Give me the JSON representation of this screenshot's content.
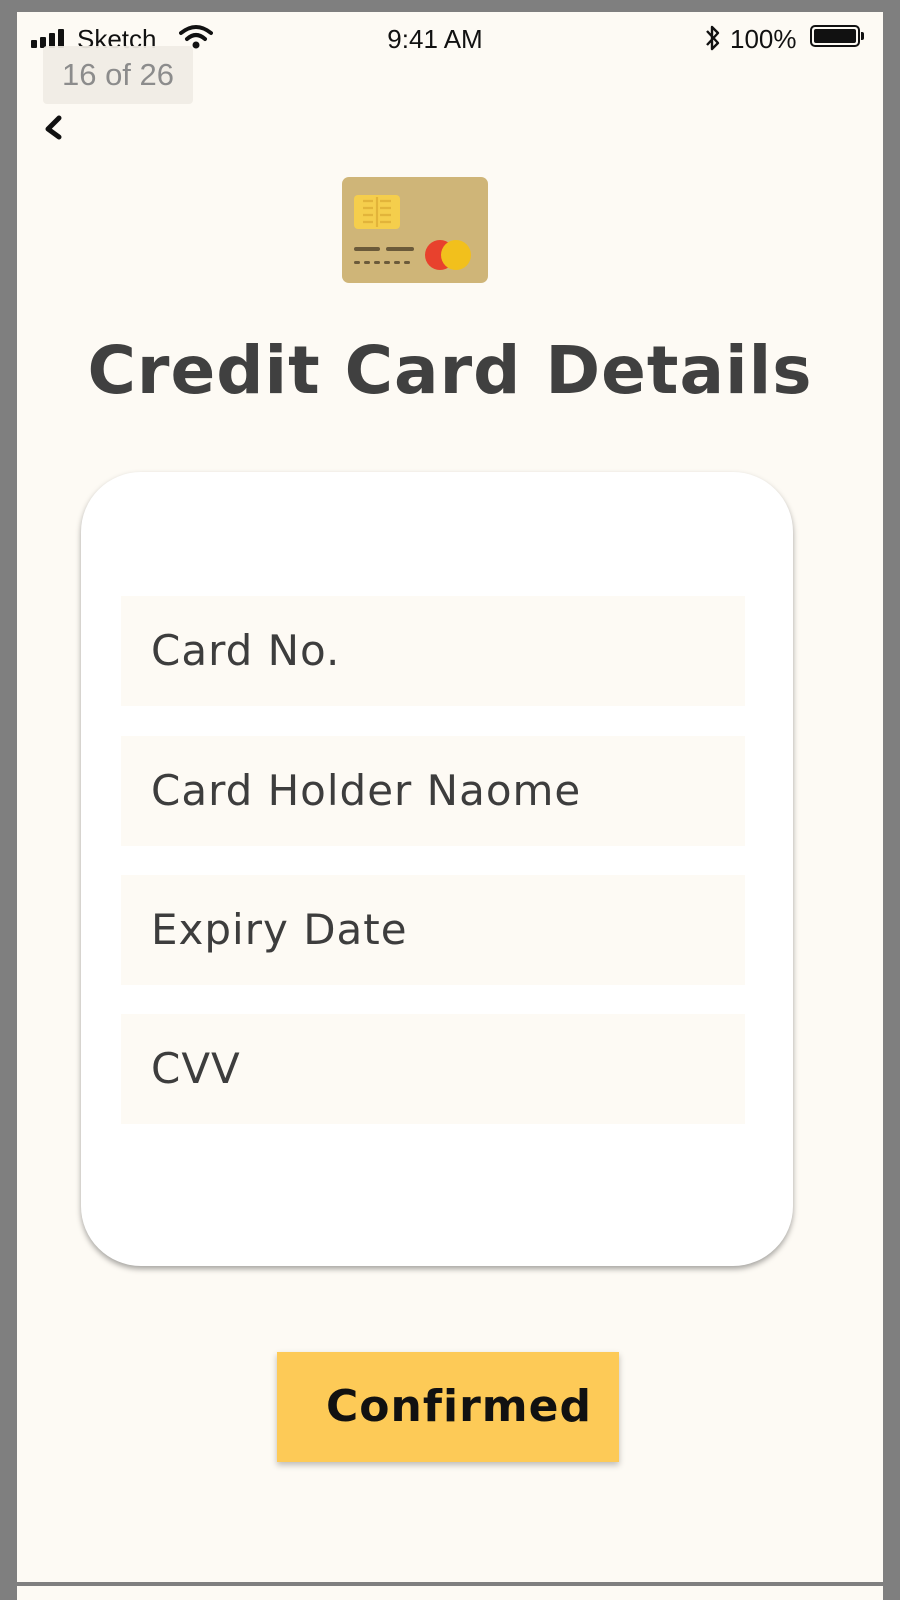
{
  "status_bar": {
    "carrier": "Sketch",
    "time": "9:41 AM",
    "battery": "100%"
  },
  "page_badge": "16 of 26",
  "title": "Credit Card Details",
  "form": {
    "fields": [
      {
        "placeholder": "Card No."
      },
      {
        "placeholder": "Card Holder Naome"
      },
      {
        "placeholder": "Expiry Date"
      },
      {
        "placeholder": "CVV"
      }
    ]
  },
  "confirm_button": "Confirmed",
  "colors": {
    "background": "#fdfaf4",
    "card_logo": "#cfb578",
    "chip": "#f5ce4c",
    "mastercard_red": "#e8412d",
    "mastercard_yellow": "#f2c01c",
    "button": "#fdca57",
    "title_text": "#404040"
  },
  "icons": [
    "signal-icon",
    "wifi-icon",
    "bluetooth-icon",
    "battery-icon",
    "back-chevron-icon",
    "credit-card-icon"
  ]
}
